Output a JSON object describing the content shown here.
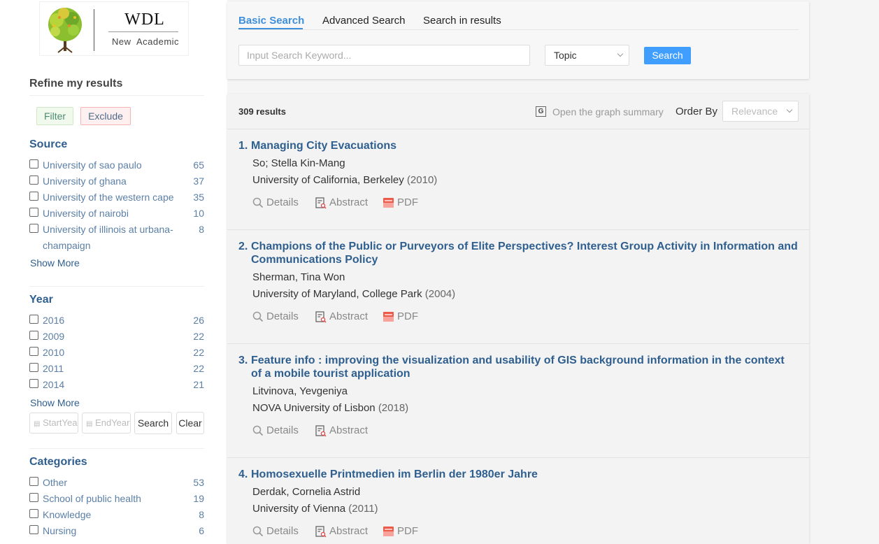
{
  "logo": {
    "title": "WDL",
    "subtitle": "New  Academic"
  },
  "sidebar": {
    "refine_title": "Refine my results",
    "filter_label": "Filter",
    "exclude_label": "Exclude",
    "source": {
      "title": "Source",
      "items": [
        {
          "label": "University of sao paulo",
          "count": "65"
        },
        {
          "label": "University of ghana",
          "count": "37"
        },
        {
          "label": "University of the western cape",
          "count": "35"
        },
        {
          "label": "University of nairobi",
          "count": "10"
        },
        {
          "label": "University of illinois at urbana-champaign",
          "count": "8"
        }
      ],
      "show_more": "Show More"
    },
    "year": {
      "title": "Year",
      "items": [
        {
          "label": "2016",
          "count": "26"
        },
        {
          "label": "2009",
          "count": "22"
        },
        {
          "label": "2010",
          "count": "22"
        },
        {
          "label": "2011",
          "count": "22"
        },
        {
          "label": "2014",
          "count": "21"
        }
      ],
      "show_more": "Show More",
      "start_placeholder": "StartYear",
      "end_placeholder": "EndYear",
      "search_label": "Search",
      "clear_label": "Clear"
    },
    "categories": {
      "title": "Categories",
      "items": [
        {
          "label": "Other",
          "count": "53"
        },
        {
          "label": "School of public health",
          "count": "19"
        },
        {
          "label": "Knowledge",
          "count": "8"
        },
        {
          "label": "Nursing",
          "count": "6"
        }
      ]
    }
  },
  "search": {
    "tabs": [
      "Basic Search",
      "Advanced Search",
      "Search in results"
    ],
    "placeholder": "Input Search Keyword...",
    "field_select": "Topic",
    "button": "Search"
  },
  "results": {
    "count_label": "309 results",
    "graph_summary": "Open the graph summary",
    "graph_icon_letter": "G",
    "order_by_label": "Order By",
    "order_by_value": "Relevance",
    "actions": {
      "details": "Details",
      "abstract": "Abstract",
      "pdf": "PDF"
    },
    "items": [
      {
        "num": "1.",
        "title": "Managing City Evacuations",
        "authors": "So; Stella Kin-Mang",
        "institution": "University of California, Berkeley",
        "year": "(2010)",
        "has_pdf": true
      },
      {
        "num": "2.",
        "title": "Champions of the Public or Purveyors of Elite Perspectives? Interest Group Activity in Information and Communications Policy",
        "authors": "Sherman, Tina Won",
        "institution": "University of Maryland, College Park",
        "year": "(2004)",
        "has_pdf": true
      },
      {
        "num": "3.",
        "title": "Feature info : improving the visualization and usability of GIS background information in the context of a mobile tourist application",
        "authors": "Litvinova, Yevgeniya",
        "institution": "NOVA University of Lisbon",
        "year": "(2018)",
        "has_pdf": false
      },
      {
        "num": "4.",
        "title": "Homosexuelle Printmedien im Berlin der 1980er Jahre",
        "authors": "Derdak, Cornelia Astrid",
        "institution": "University of Vienna",
        "year": "(2011)",
        "has_pdf": true
      }
    ]
  },
  "colors": {
    "accent": "#409eff",
    "link": "#2f5f8f",
    "facet": "#5b7fa6"
  }
}
